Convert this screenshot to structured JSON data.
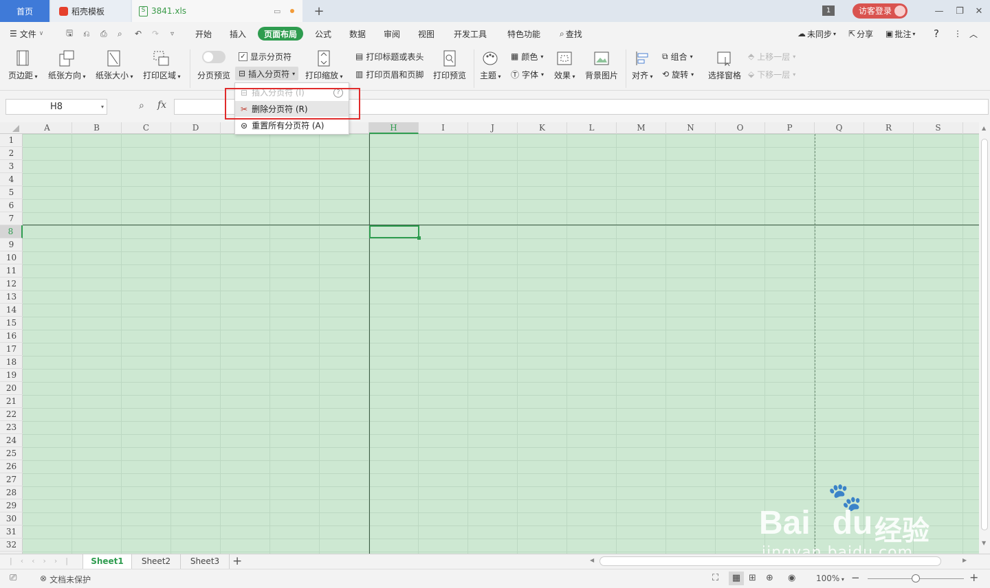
{
  "tabs": {
    "home": "首页",
    "template": "稻壳模板",
    "file": "3841.xls",
    "badge": "1",
    "login": "访客登录"
  },
  "menu": {
    "file": "文件",
    "items": [
      "开始",
      "插入",
      "页面布局",
      "公式",
      "数据",
      "审阅",
      "视图",
      "开发工具",
      "特色功能"
    ],
    "search": "查找",
    "sync": "未同步",
    "share": "分享",
    "comment": "批注"
  },
  "ribbon": {
    "margin": "页边距",
    "orientation": "纸张方向",
    "size": "纸张大小",
    "print_area": "打印区域",
    "break_preview": "分页预览",
    "show_breaks": "显示分页符",
    "insert_break": "插入分页符",
    "print_scale": "打印缩放",
    "print_titles": "打印标题或表头",
    "header_footer": "打印页眉和页脚",
    "print_preview": "打印预览",
    "theme": "主题",
    "color": "颜色",
    "font": "字体",
    "effect": "效果",
    "bg_image": "背景图片",
    "align": "对齐",
    "group": "组合",
    "rotate": "旋转",
    "select_pane": "选择窗格",
    "bring_forward": "上移一层",
    "send_backward": "下移一层"
  },
  "dropdown": {
    "insert": "插入分页符 (I)",
    "delete": "删除分页符 (R)",
    "reset": "重置所有分页符 (A)"
  },
  "formula": {
    "cell_ref": "H8",
    "fx": "fx",
    "value": ""
  },
  "columns": [
    "A",
    "B",
    "C",
    "D",
    "E",
    "F",
    "G",
    "H",
    "I",
    "J",
    "K",
    "L",
    "M",
    "N",
    "O",
    "P",
    "Q",
    "R",
    "S"
  ],
  "rows": [
    "1",
    "2",
    "3",
    "4",
    "5",
    "6",
    "7",
    "8",
    "9",
    "10",
    "11",
    "12",
    "13",
    "14",
    "15",
    "16",
    "17",
    "18",
    "19",
    "20",
    "21",
    "22",
    "23",
    "24",
    "25",
    "26",
    "27",
    "28",
    "29",
    "30",
    "31",
    "32"
  ],
  "selected": {
    "column": "H",
    "row": "8"
  },
  "sheets": [
    "Sheet1",
    "Sheet2",
    "Sheet3"
  ],
  "active_sheet": "Sheet1",
  "status": {
    "protect": "文档未保护",
    "zoom": "100%"
  },
  "watermark": {
    "brand": "Bai",
    "brand2": "du",
    "cn": "经验",
    "url": "jingyan.baidu.com"
  },
  "colors": {
    "accent": "#2e9c4f",
    "home_tab": "#3f7ad8",
    "highlight": "#e02a2a",
    "sheet_bg": "#cde8d2"
  }
}
